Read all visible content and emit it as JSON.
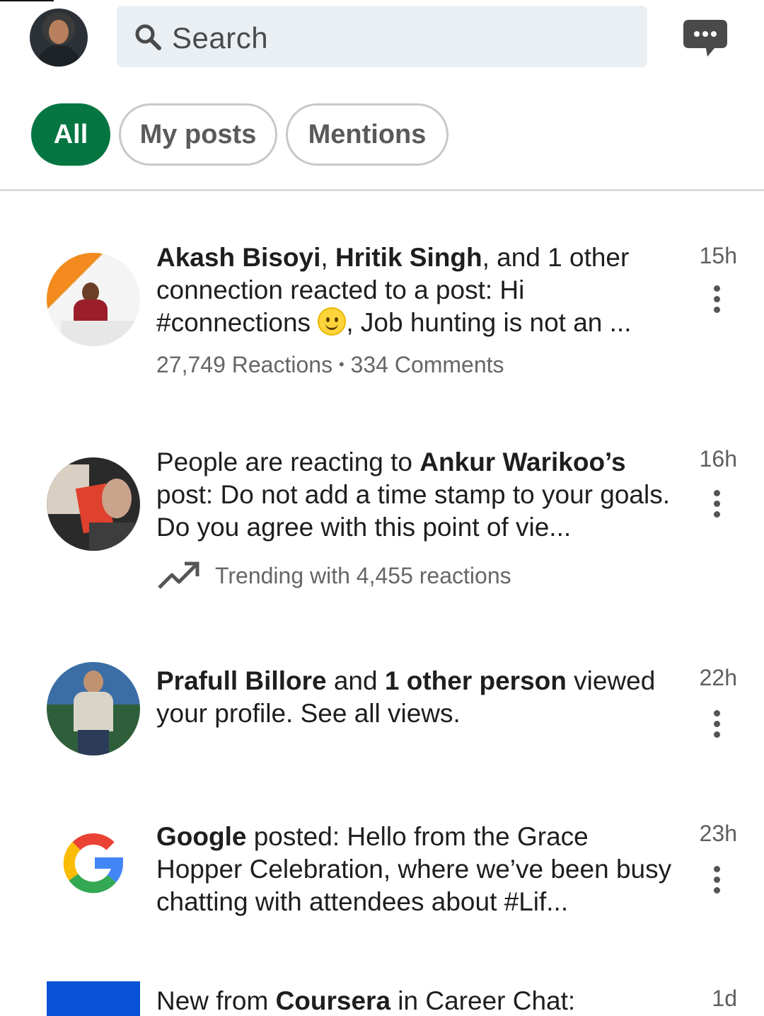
{
  "search": {
    "placeholder": "Search"
  },
  "filters": {
    "all": "All",
    "my_posts": "My posts",
    "mentions": "Mentions"
  },
  "items": [
    {
      "bold1": "Akash Bisoyi",
      "sep1": ", ",
      "bold2": "Hritik Singh",
      "rest": ", and 1 other connection reacted to a post: Hi #connections ",
      "rest2": ", Job hunting is not an ...",
      "time": "15h",
      "reactions": "27,749 Reactions",
      "dot": "•",
      "comments": "334 Comments"
    },
    {
      "pre": "People are reacting to ",
      "bold1": "Ankur Warikoo’s",
      "rest": " post: Do not add a time stamp to your goals. Do you agree with this point of vie...",
      "time": "16h",
      "trending": "Trending with 4,455 reactions"
    },
    {
      "bold1": "Prafull Billore",
      "mid": " and ",
      "bold2": "1 other person",
      "rest": " viewed your profile. See all views.",
      "time": "22h"
    },
    {
      "bold1": "Google",
      "rest": " posted: Hello from the Grace Hopper Celebration, where we’ve been busy chatting with attendees about #Lif...",
      "time": "23h"
    },
    {
      "pre": "New from ",
      "bold1": "Coursera",
      "rest": " in Career Chat:",
      "time": "1d"
    }
  ],
  "colors": {
    "accent": "#057642",
    "coursera": "#0a52d6"
  },
  "icons": {
    "search": "search-icon",
    "messaging": "messaging-icon",
    "more": "more-vertical-icon",
    "trending": "trending-up-icon"
  }
}
